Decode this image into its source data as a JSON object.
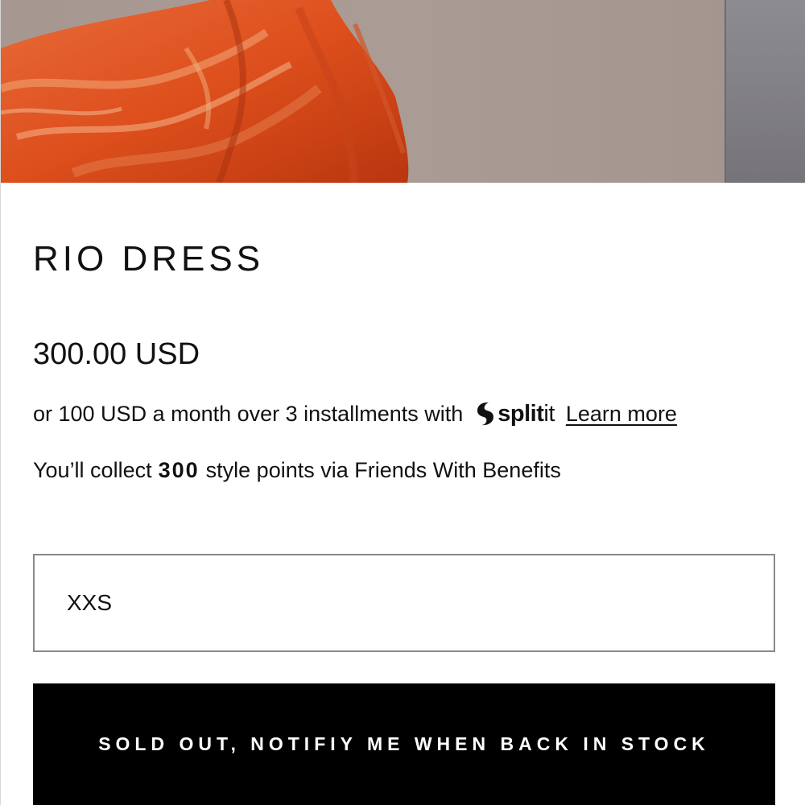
{
  "product": {
    "title": "RIO DRESS",
    "price": "300.00 USD",
    "installments": {
      "text": "or 100 USD a month over 3 installments with",
      "provider_bold": "split",
      "provider_light": "it",
      "link_label": "Learn more"
    },
    "points": {
      "prefix": "You’ll collect",
      "amount": "300",
      "suffix": "style points via Friends With Benefits"
    },
    "size_select": {
      "selected": "XXS"
    },
    "cta_label": "SOLD OUT, NOTIFIY ME WHEN BACK IN STOCK"
  },
  "colors": {
    "dress": "#e0521e",
    "background": "#ffffff",
    "button": "#000000"
  }
}
